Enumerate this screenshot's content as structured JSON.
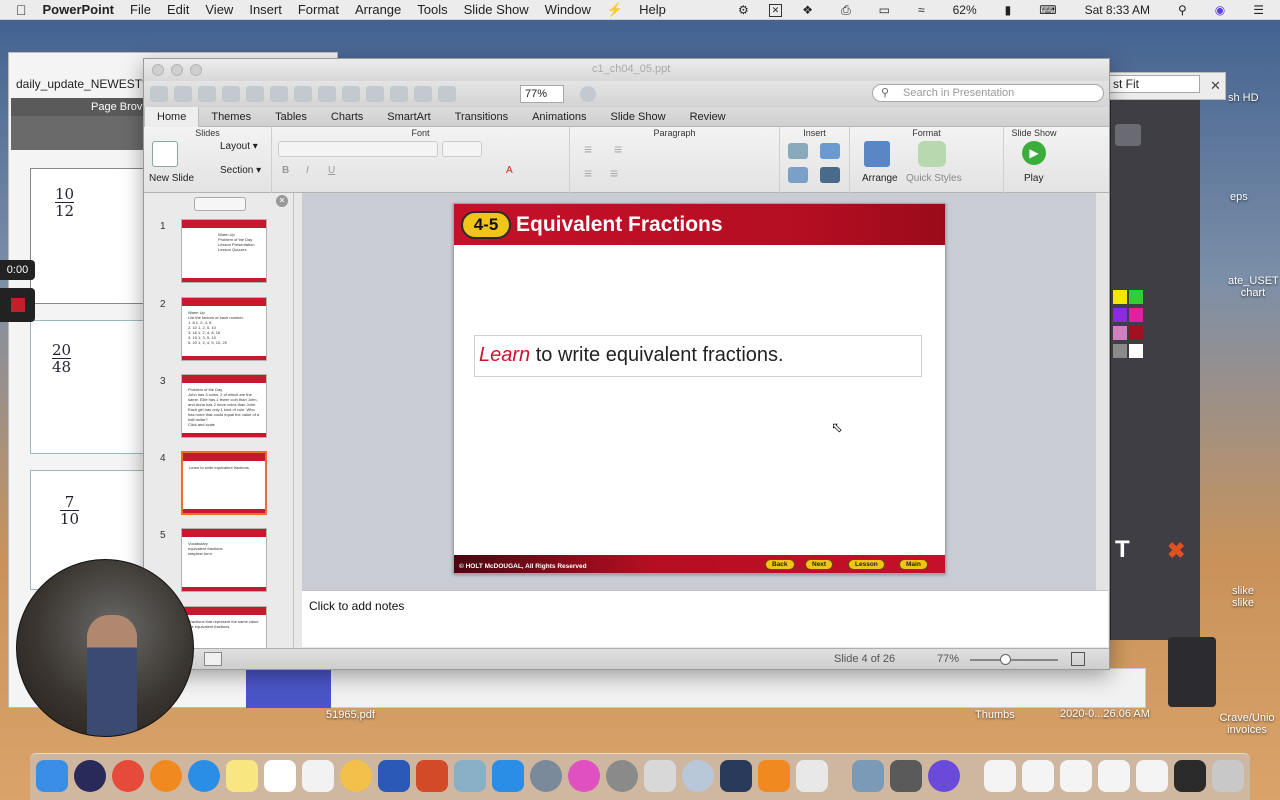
{
  "menubar": {
    "apple": "",
    "app_name": "PowerPoint",
    "items": [
      "File",
      "Edit",
      "View",
      "Insert",
      "Format",
      "Arrange",
      "Tools",
      "Slide Show",
      "Window",
      "Help"
    ],
    "battery": "62%",
    "clock": "Sat 8:33 AM"
  },
  "background": {
    "daily_update_title": "daily_update_NEWEST*",
    "page_browser_title": "Page Brov",
    "fit_label": "st Fit",
    "recording_time": "0:00",
    "notebook_fractions": [
      {
        "num": "10",
        "den": "12"
      },
      {
        "num": "20",
        "den": "48"
      },
      {
        "num": "7",
        "den": "10"
      }
    ],
    "desktop_labels": {
      "pdf": "51965.pdf",
      "thumbs": "Thumbs",
      "date_file": "2020-0...26.06 AM",
      "crave": "Crave/Unio invoices",
      "sh_hd": "sh HD",
      "eps": "eps",
      "ate_uset": "ate_USET chart",
      "slike": "slike slike"
    }
  },
  "ppt": {
    "window_title": "c1_ch04_05.ppt",
    "zoom_combo": "77%",
    "search_placeholder": "Search in Presentation",
    "tabs": [
      "Home",
      "Themes",
      "Tables",
      "Charts",
      "SmartArt",
      "Transitions",
      "Animations",
      "Slide Show",
      "Review"
    ],
    "active_tab": "Home",
    "ribbon": {
      "slides_group": "Slides",
      "new_slide": "New Slide",
      "layout": "Layout",
      "section": "Section",
      "font_group": "Font",
      "paragraph_group": "Paragraph",
      "insert_group": "Insert",
      "format_group": "Format",
      "arrange": "Arrange",
      "quick_styles": "Quick Styles",
      "slideshow_group": "Slide Show",
      "play": "Play"
    },
    "thumbnails": [
      {
        "num": "1",
        "text": "Warm Up\nProblem of the Day\nLesson Presentation\nLesson Quizzes"
      },
      {
        "num": "2",
        "text": "Warm Up\nList the factors of each number.\n1. 8  1, 2, 4, 8\n2. 10  1, 2, 5, 10\n3. 16  1, 2, 4, 8, 16\n4. 15  1, 3, 5, 15\n5. 20  1, 2, 4, 5, 10, 20"
      },
      {
        "num": "3",
        "text": "Problem of the Day\nJohn has 3 coins, 2 of which are the same. Ellie has 1 fewer coin than John, and Anna has 2 more coins than John. Each girl has only 1 kind of coin. Who has more that could equal the value of a half dollar?\nClick and scale"
      },
      {
        "num": "4",
        "text": "Learn to write equivalent fractions."
      },
      {
        "num": "5",
        "text": "Vocabulary\nequivalent fractions\nsimplest form"
      },
      {
        "num": "6",
        "text": "Fractions that represent the same value are equivalent fractions."
      }
    ],
    "slide": {
      "badge": "4-5",
      "title": "Equivalent Fractions",
      "objective_italic": "Learn",
      "objective_rest": " to write equivalent fractions.",
      "copyright": "© HOLT McDOUGAL, All Rights Reserved",
      "nav": [
        "Back",
        "Next",
        "Lesson",
        "Main"
      ]
    },
    "notes_placeholder": "Click to add notes",
    "status_slide": "Slide 4 of 26",
    "status_zoom": "77%",
    "zoom_level": 0.4
  },
  "colors": {
    "slide_red": "#c5102a",
    "badge_yellow": "#f0c419",
    "selected_thumb": "#e8702a"
  }
}
